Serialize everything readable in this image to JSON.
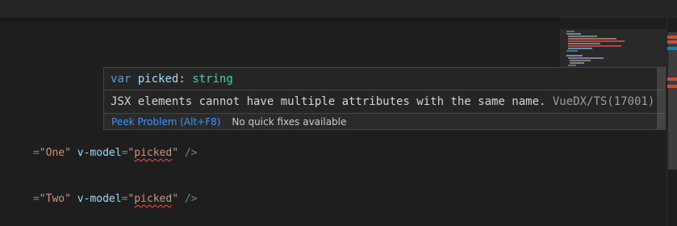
{
  "editor": {
    "lines": [
      {
        "pre": "=",
        "value": "\"One\"",
        "attr": "v-model",
        "eq": "=",
        "q1": "\"",
        "model": "picked",
        "q2": "\"",
        "close": " />"
      },
      {
        "pre": "=",
        "value": "\"Two\"",
        "attr": "v-model",
        "eq": "=",
        "q1": "\"",
        "model": "picked",
        "q2": "\"",
        "close": " />"
      }
    ]
  },
  "hover": {
    "keyword": "var",
    "identifier": "picked",
    "colon": ":",
    "type": "string",
    "message": "JSX elements cannot have multiple attributes with the same name.",
    "source": "VueDX/TS(17001)",
    "peek_label": "Peek Problem (Alt+F8)",
    "no_fix_label": "No quick fixes available"
  },
  "colors": {
    "background": "#1e1e1e",
    "hover_background": "#252526",
    "link": "#3794ff",
    "error": "#f14c4c",
    "string": "#ce9178",
    "attribute": "#9cdcfe",
    "type": "#4ec9b0",
    "keyword": "#569cd6"
  }
}
